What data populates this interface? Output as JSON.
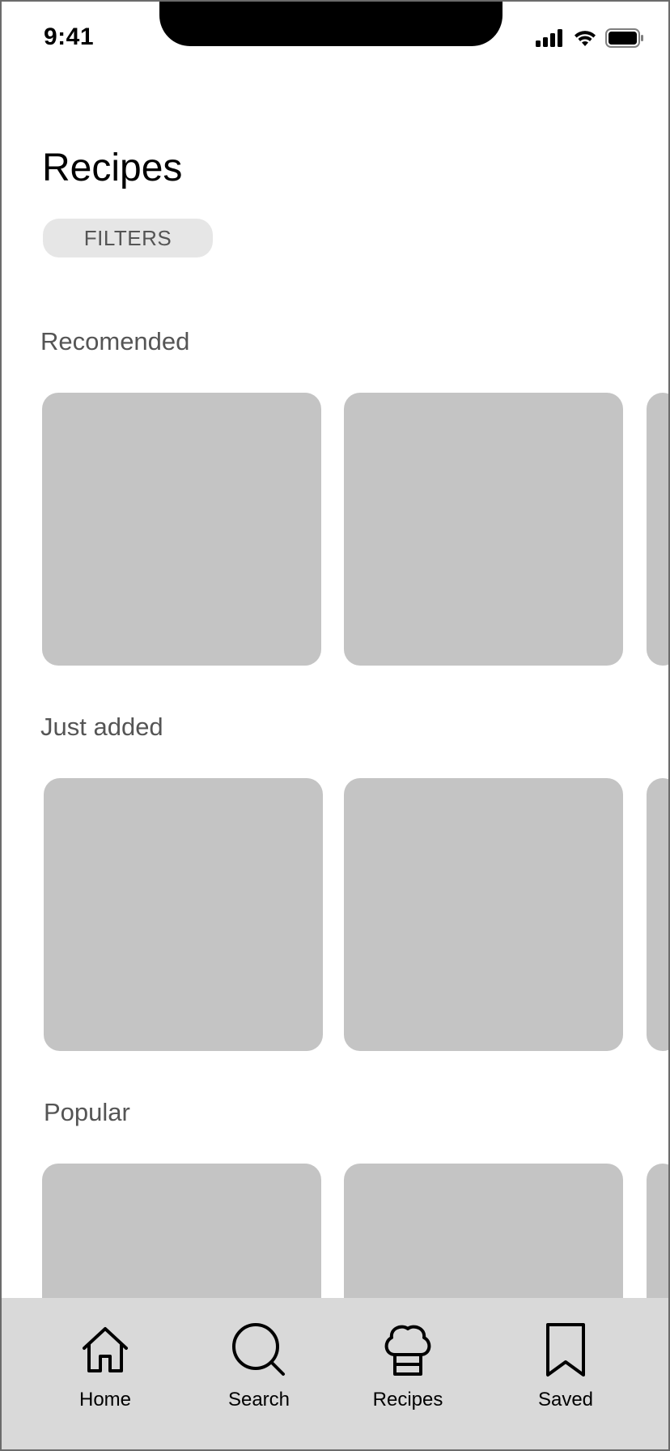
{
  "status_bar": {
    "time": "9:41",
    "icons": [
      "signal-icon",
      "wifi-icon",
      "battery-icon"
    ]
  },
  "header": {
    "title": "Recipes",
    "filters_label": "FILTERS"
  },
  "sections": [
    {
      "title": "Recomended",
      "card_count_visible": 3
    },
    {
      "title": "Just added",
      "card_count_visible": 3
    },
    {
      "title": "Popular",
      "card_count_visible": 3
    }
  ],
  "bottom_nav": {
    "items": [
      {
        "label": "Home",
        "icon": "home-icon"
      },
      {
        "label": "Search",
        "icon": "search-icon"
      },
      {
        "label": "Recipes",
        "icon": "chef-hat-icon"
      },
      {
        "label": "Saved",
        "icon": "bookmark-icon"
      }
    ]
  },
  "colors": {
    "card_placeholder": "#c4c4c4",
    "nav_background": "#d9d9d9",
    "filters_background": "#e6e6e6",
    "section_text": "#555555"
  }
}
